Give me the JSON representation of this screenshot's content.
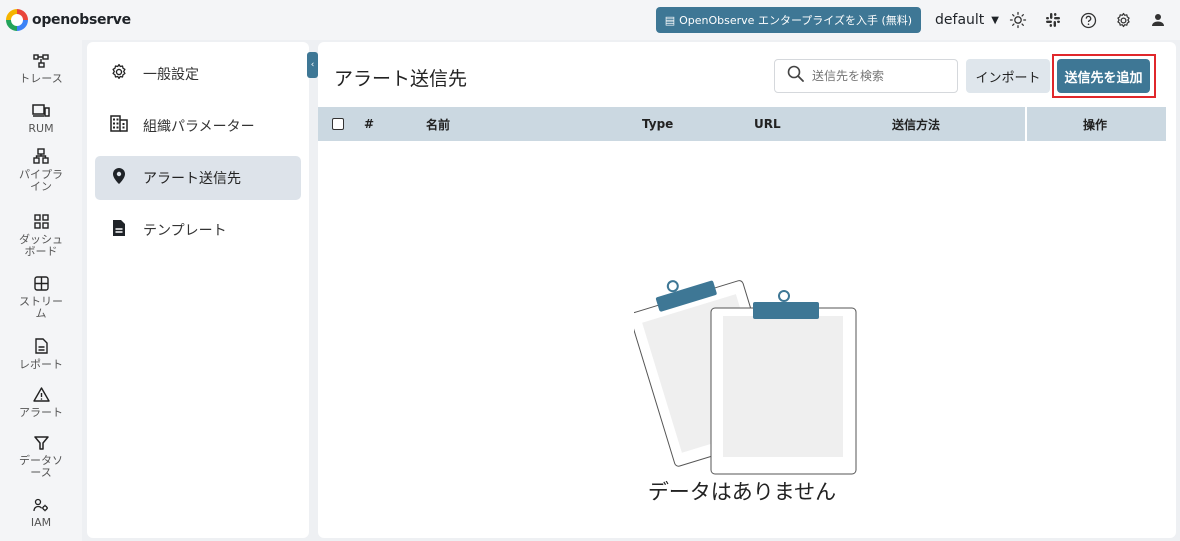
{
  "app": {
    "logo_text": "openobserve",
    "brand_color": "#3e7795"
  },
  "header": {
    "enterprise_button": "OpenObserve エンタープライズを入手 (無料)",
    "org_selector": "default",
    "icons": [
      "theme-toggle-icon",
      "slack-icon",
      "help-icon",
      "settings-icon",
      "user-icon"
    ]
  },
  "leftnav": {
    "items": [
      {
        "icon": "traces-icon",
        "label": "トレース"
      },
      {
        "icon": "rum-icon",
        "label": "RUM"
      },
      {
        "icon": "pipeline-icon",
        "label": "パイプライン"
      },
      {
        "icon": "dashboard-icon",
        "label": "ダッシュボード"
      },
      {
        "icon": "streams-icon",
        "label": "ストリーム"
      },
      {
        "icon": "report-icon",
        "label": "レポート"
      },
      {
        "icon": "alert-icon",
        "label": "アラート"
      },
      {
        "icon": "datasource-icon",
        "label": "データソース"
      },
      {
        "icon": "iam-icon",
        "label": "IAM"
      }
    ]
  },
  "settings_menu": {
    "items": [
      {
        "icon": "gear-icon",
        "label": "一般設定",
        "active": false
      },
      {
        "icon": "building-icon",
        "label": "組織パラメーター",
        "active": false
      },
      {
        "icon": "location-pin-icon",
        "label": "アラート送信先",
        "active": true
      },
      {
        "icon": "document-icon",
        "label": "テンプレート",
        "active": false
      }
    ]
  },
  "main": {
    "title": "アラート送信先",
    "search": {
      "placeholder": "送信先を検索",
      "value": ""
    },
    "import_button": "インポート",
    "add_button": "送信先を追加",
    "table": {
      "columns": [
        "#",
        "名前",
        "Type",
        "URL",
        "送信方法",
        "操作"
      ],
      "rows": []
    },
    "empty_message": "データはありません"
  }
}
